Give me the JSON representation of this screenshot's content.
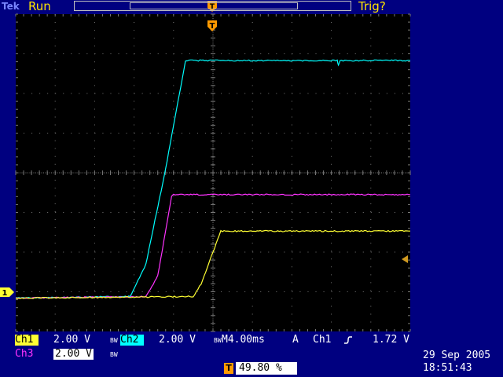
{
  "header": {
    "brand": "Tek",
    "acq_state": "Run",
    "trigger_state": "Trig?"
  },
  "colors": {
    "frame_bg": "#000080",
    "screen_bg": "#000000",
    "grid": "#777777",
    "ch1": "#ffff33",
    "ch2": "#00ffff",
    "ch3": "#ff33ff",
    "trigger_marker": "#ff9a00"
  },
  "markers": {
    "ch1_ground": "1",
    "trigger_position": "T"
  },
  "channels": [
    {
      "label": "Ch1",
      "scale": "2.00 V",
      "bw_mark": "BW"
    },
    {
      "label": "Ch2",
      "scale": "2.00 V",
      "bw_mark": "BW"
    },
    {
      "label": "Ch3",
      "scale": "2.00 V",
      "bw_mark": "BW"
    }
  ],
  "timebase": {
    "text": "M4.00ms"
  },
  "trigger": {
    "mode": "A",
    "source": "Ch1",
    "slope_icon": "rising-edge-icon",
    "level": "1.72 V",
    "position": "49.80 %"
  },
  "datetime": {
    "date": "29 Sep  2005",
    "time": "18:51:43"
  },
  "chart_data": {
    "type": "line",
    "x_divisions": 10,
    "y_divisions": 8,
    "x_unit": "div",
    "y_unit": "div",
    "xlim": [
      0,
      10
    ],
    "ylim": [
      -4,
      4
    ],
    "series": [
      {
        "name": "Ch2",
        "color": "#00ffff",
        "points": [
          [
            0,
            -3.16
          ],
          [
            2.9,
            -3.12
          ],
          [
            3.3,
            -2.3
          ],
          [
            3.8,
            0.1
          ],
          [
            4.3,
            2.8
          ],
          [
            4.35,
            2.83
          ],
          [
            8.15,
            2.83
          ],
          [
            8.18,
            2.7
          ],
          [
            8.22,
            2.83
          ],
          [
            10,
            2.83
          ]
        ]
      },
      {
        "name": "Ch3",
        "color": "#ff33ff",
        "points": [
          [
            0,
            -3.16
          ],
          [
            3.3,
            -3.12
          ],
          [
            3.6,
            -2.6
          ],
          [
            3.95,
            -0.6
          ],
          [
            4.0,
            -0.55
          ],
          [
            10,
            -0.55
          ]
        ]
      },
      {
        "name": "Ch1",
        "color": "#ffff33",
        "points": [
          [
            0,
            -3.16
          ],
          [
            4.5,
            -3.12
          ],
          [
            4.7,
            -2.8
          ],
          [
            5.0,
            -2.0
          ],
          [
            5.2,
            -1.47
          ],
          [
            10,
            -1.47
          ]
        ]
      }
    ]
  }
}
